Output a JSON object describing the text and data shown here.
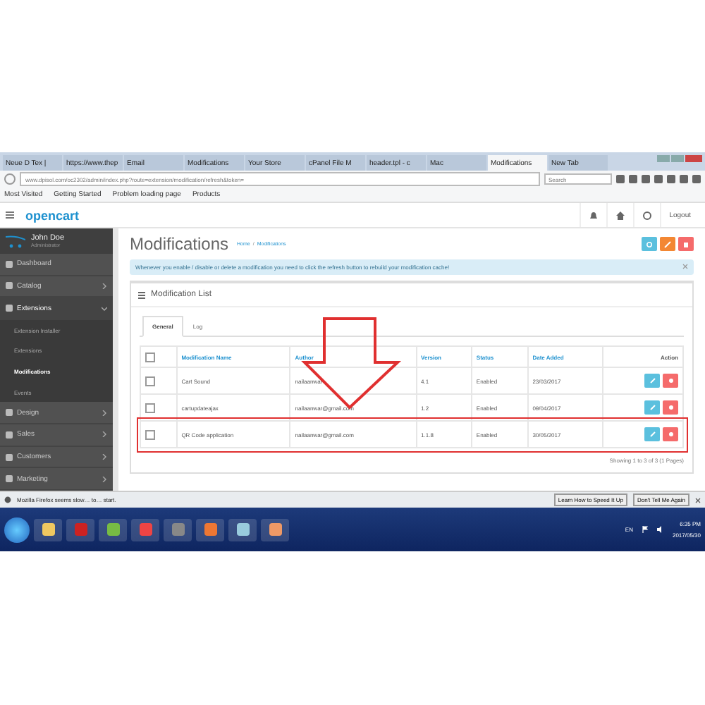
{
  "browser": {
    "tabs": [
      {
        "label": "Neue D Tex |",
        "selected": false
      },
      {
        "label": "https://www.thep",
        "selected": false
      },
      {
        "label": "Email",
        "selected": false
      },
      {
        "label": "Modifications",
        "selected": false
      },
      {
        "label": "Your Store",
        "selected": false
      },
      {
        "label": "cPanel File M",
        "selected": false
      },
      {
        "label": "header.tpl - c",
        "selected": false
      },
      {
        "label": "Mac",
        "selected": false
      },
      {
        "label": "Modifications",
        "selected": true
      },
      {
        "label": "New Tab",
        "selected": false
      }
    ],
    "url": "www.dpisol.com/oc2302/admin/index.php?route=extension/modification/refresh&token=",
    "search": {
      "placeholder": "Search"
    },
    "bookmarks": [
      "Most Visited",
      "Getting Started",
      "Problem loading page",
      "Products"
    ]
  },
  "header": {
    "brand": "opencart",
    "logout": "Logout"
  },
  "sidebar": {
    "user": {
      "name": "John Doe",
      "role": "Administrator"
    },
    "items": [
      {
        "label": "Dashboard",
        "kind": "link"
      },
      {
        "label": "Catalog",
        "kind": "menu",
        "expanded": false
      },
      {
        "label": "Extensions",
        "kind": "menu",
        "expanded": true,
        "children": [
          {
            "label": "Extension Installer",
            "selected": false
          },
          {
            "label": "Extensions",
            "selected": false
          },
          {
            "label": "Modifications",
            "selected": true
          },
          {
            "label": "Events",
            "selected": false
          }
        ]
      },
      {
        "label": "Design",
        "kind": "menu",
        "expanded": false
      },
      {
        "label": "Sales",
        "kind": "menu",
        "expanded": false
      },
      {
        "label": "Customers",
        "kind": "menu",
        "expanded": false
      },
      {
        "label": "Marketing",
        "kind": "menu",
        "expanded": false
      }
    ]
  },
  "page": {
    "title": "Modifications",
    "breadcrumb": [
      "Home",
      "Modifications"
    ],
    "breadcrumb_separator": "/",
    "alert": "Whenever you enable / disable or delete a modification you need to click the refresh button to rebuild your modification cache!",
    "panel_title": "Modification List",
    "tabs": [
      {
        "label": "General",
        "selected": true
      },
      {
        "label": "Log",
        "selected": false
      }
    ],
    "table": {
      "select_all": {
        "checked": false
      },
      "columns": [
        "Modification Name",
        "Author",
        "Version",
        "Status",
        "Date Added",
        "Action"
      ],
      "rows": [
        {
          "checked": false,
          "highlighted": false,
          "cells": [
            "Cart Sound",
            "nailaanwar",
            "4.1",
            "Enabled",
            "23/03/2017"
          ]
        },
        {
          "checked": false,
          "highlighted": false,
          "cells": [
            "cartupdateajax",
            "nailaanwar@gmail.com",
            "1.2",
            "Enabled",
            "09/04/2017"
          ]
        },
        {
          "checked": false,
          "highlighted": true,
          "cells": [
            "QR Code application",
            "nailaanwar@gmail.com",
            "1.1.8",
            "Enabled",
            "30/05/2017"
          ]
        }
      ]
    },
    "pagination": "Showing 1 to 3 of 3 (1 Pages)"
  },
  "notification": {
    "text": "Mozilla Firefox seems slow… to… start.",
    "buttons": [
      "Learn How to Speed It Up",
      "Don't Tell Me Again"
    ]
  },
  "taskbar": {
    "language": "EN",
    "time": "6:35 PM",
    "date": "2017/05/30"
  }
}
